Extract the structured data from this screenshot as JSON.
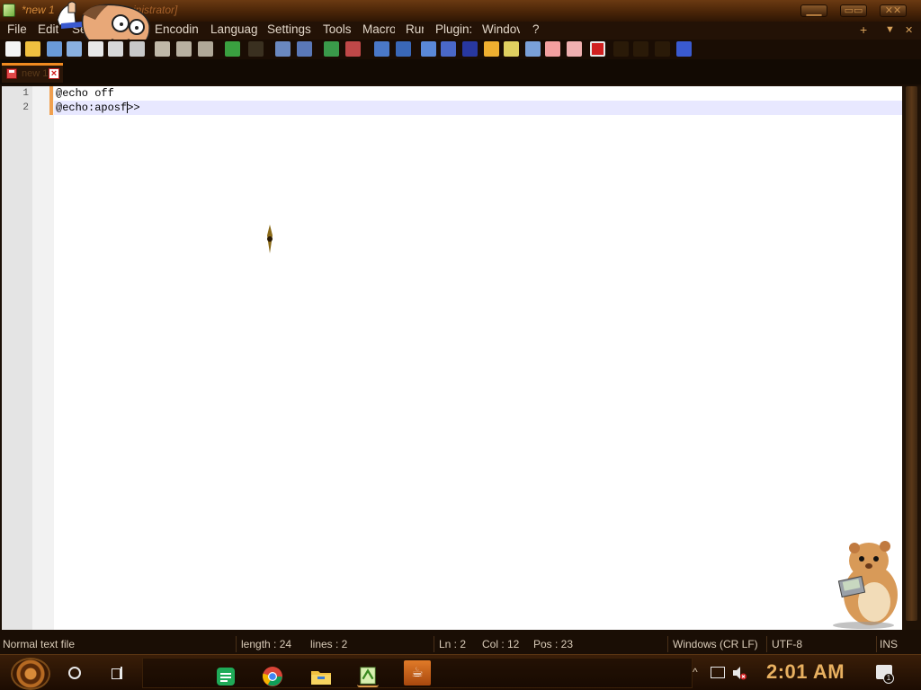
{
  "window": {
    "title": "*new 1",
    "title_suffix": "inistrator]",
    "controls": [
      "minimize",
      "maximize",
      "close"
    ]
  },
  "menu": {
    "items": [
      "File",
      "Edit",
      "Se",
      "Encodin",
      "Languag",
      "Settings",
      "Tools",
      "Macro",
      "Rur",
      "Plugin:",
      "Windov",
      "?"
    ],
    "right_plus": "+",
    "right_arrow": "▼",
    "right_close": "✕"
  },
  "toolbar": {
    "buttons": [
      "new-file",
      "open-file",
      "save",
      "save-all",
      "close",
      "close-all",
      "print",
      "cut",
      "copy",
      "paste",
      "undo",
      "redo",
      "find",
      "replace",
      "zoom-in",
      "zoom-out",
      "sync-v",
      "sync-h",
      "wrap",
      "show-all-chars",
      "indent-guide",
      "udl",
      "doc-map",
      "function-list",
      "folder-as-workspace",
      "monitoring",
      "record-macro",
      "stop-record",
      "play-macro",
      "run-macro-multiple",
      "save-macro"
    ]
  },
  "tab": {
    "label": "new 1",
    "close": "×"
  },
  "editor": {
    "lines": [
      {
        "number": "1",
        "text": "@echo off"
      },
      {
        "number": "2",
        "before_caret": "@echo:aposf",
        "after_caret": ">>"
      }
    ]
  },
  "status": {
    "file_type": "Normal text file",
    "length": "length : 24",
    "lines": "lines : 2",
    "ln": "Ln : 2",
    "col": "Col : 12",
    "pos": "Pos : 23",
    "eol": "Windows (CR LF)",
    "encoding": "UTF-8",
    "mode": "INS"
  },
  "taskbar": {
    "apps": [
      "google-sheets",
      "chrome",
      "file-explorer",
      "notepad-plus-plus",
      "java"
    ],
    "java_glyph": "☕",
    "tray_chevron": "^",
    "clock": "2:01 AM",
    "notification_count": "1"
  },
  "colors": {
    "accent": "#f08a20",
    "current_line": "#e8e8ff",
    "clock": "#e8b060"
  }
}
